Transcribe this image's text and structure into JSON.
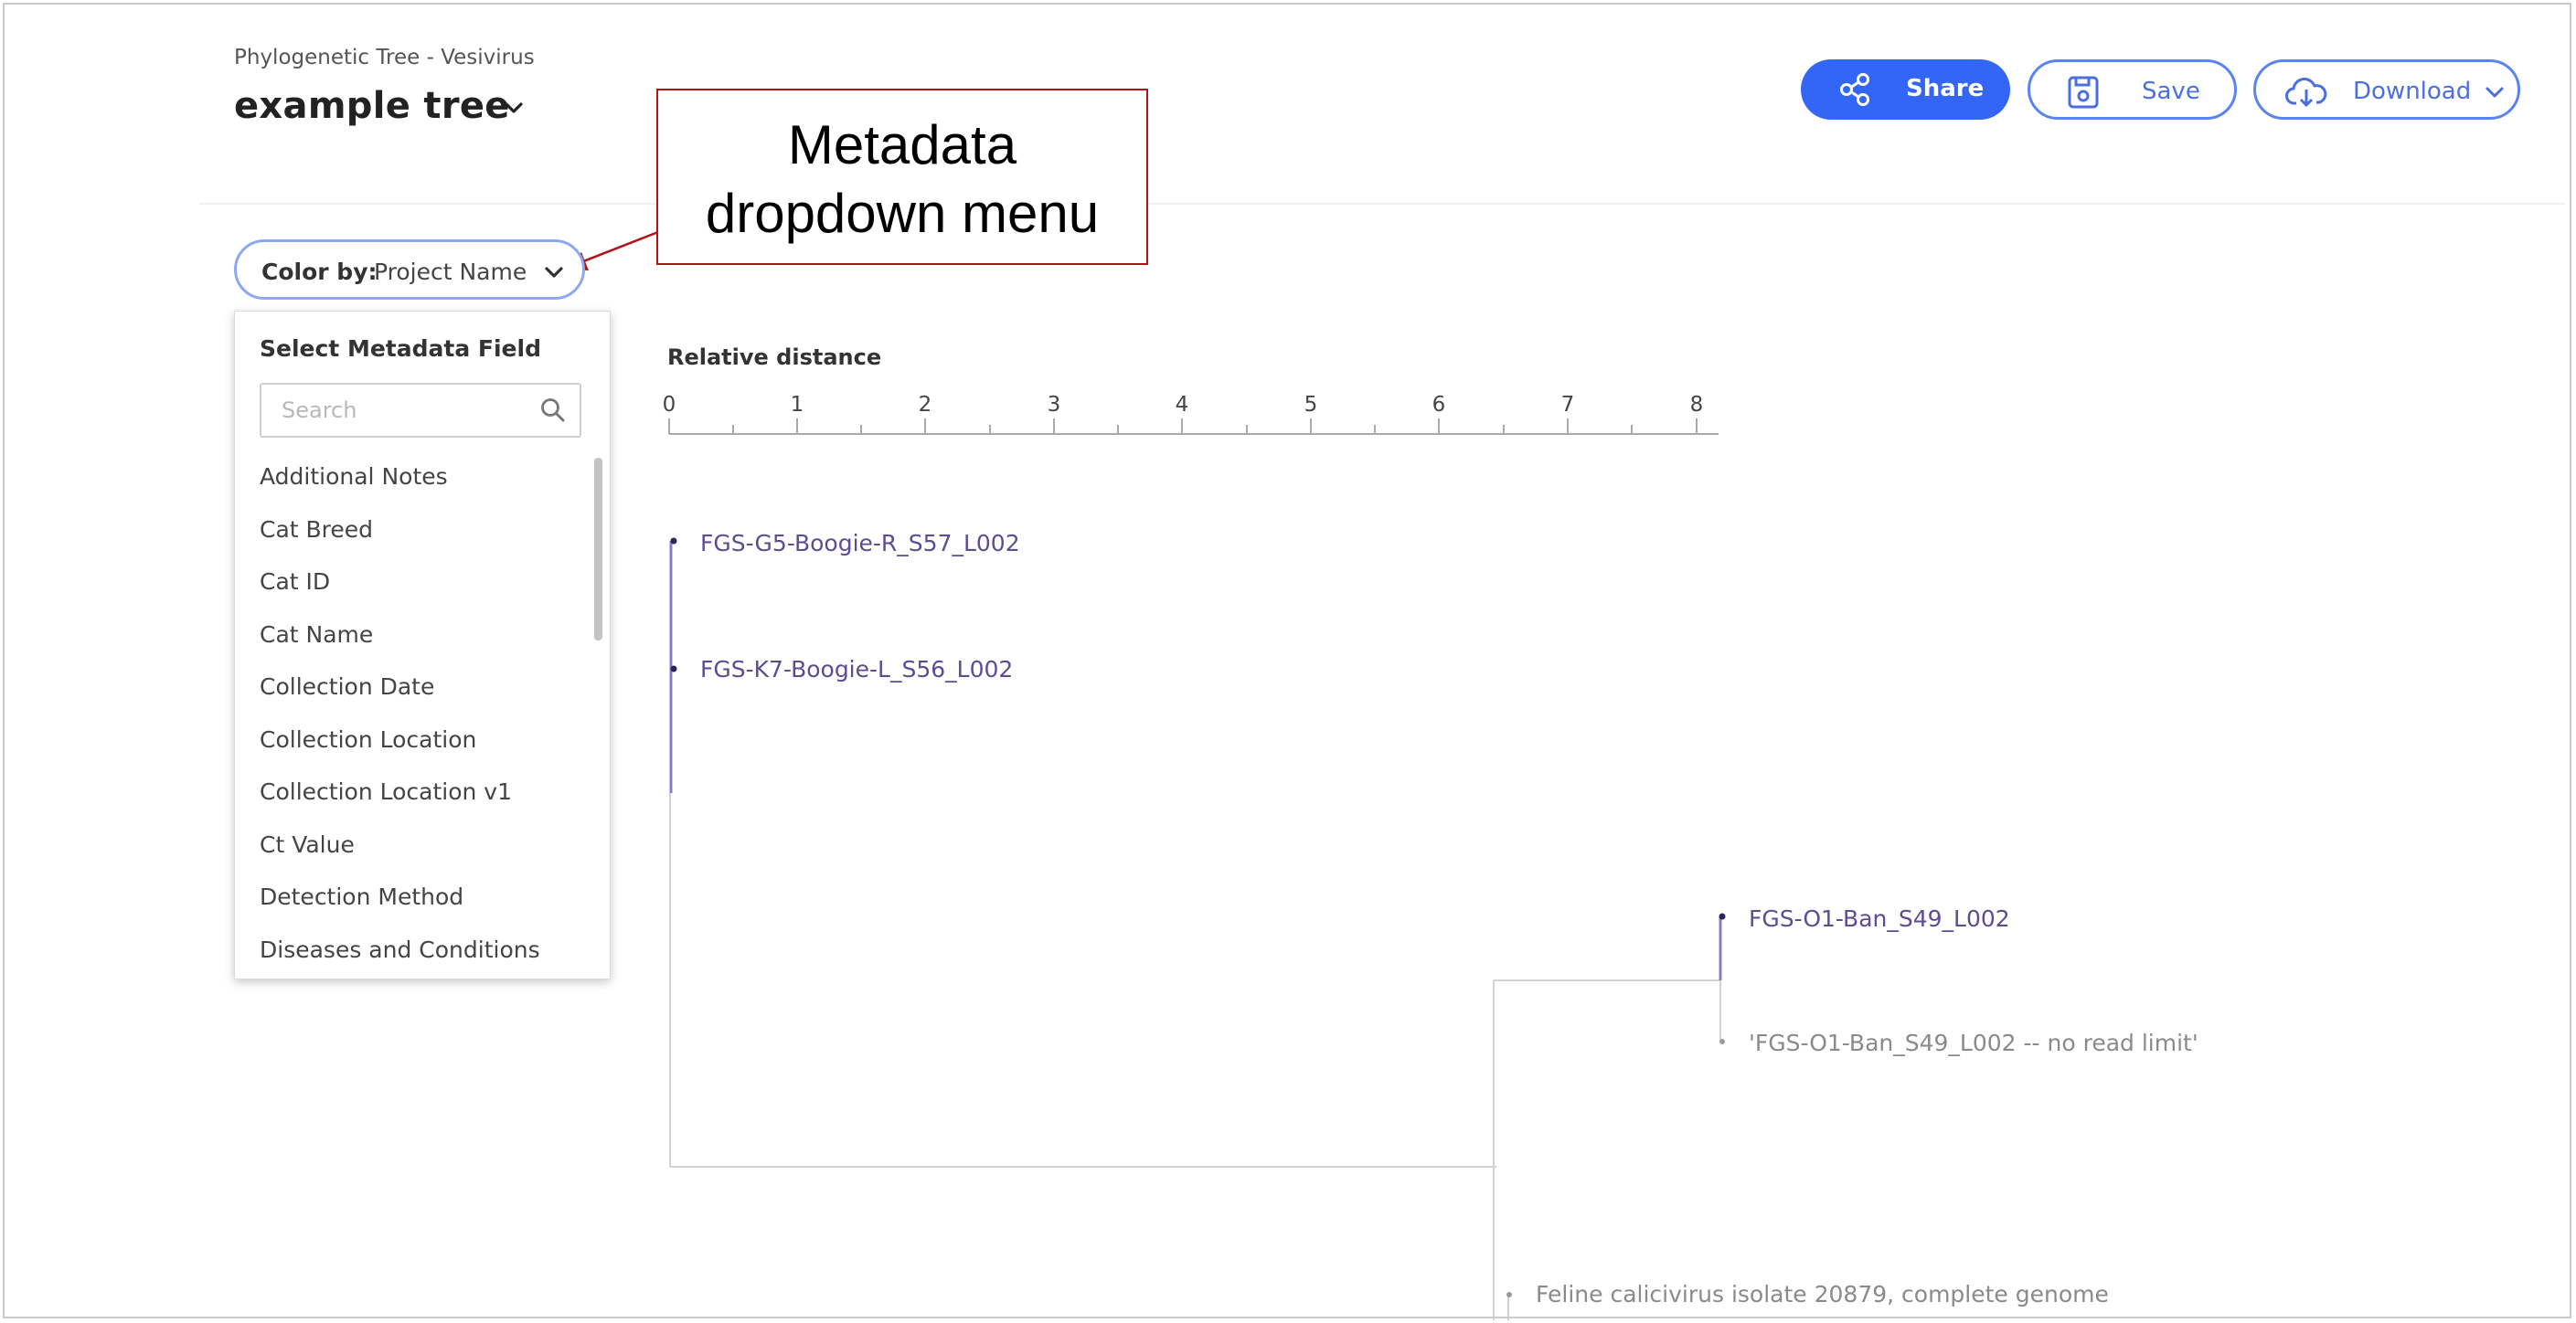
{
  "header": {
    "subtitle": "Phylogenetic Tree - Vesivirus",
    "title": "example tree"
  },
  "toolbar": {
    "share_label": "Share",
    "save_label": "Save",
    "download_label": "Download"
  },
  "annotation": {
    "line1": "Metadata",
    "line2": "dropdown menu"
  },
  "color_by": {
    "key": "Color by:",
    "value": "Project Name"
  },
  "dropdown": {
    "header": "Select Metadata Field",
    "search_placeholder": "Search",
    "items": [
      "Additional Notes",
      "Cat Breed",
      "Cat ID",
      "Cat Name",
      "Collection Date",
      "Collection Location",
      "Collection Location v1",
      "Ct Value",
      "Detection Method",
      "Diseases and Conditions"
    ]
  },
  "tree": {
    "axis_title": "Relative distance",
    "ticks": [
      "0",
      "1",
      "2",
      "3",
      "4",
      "5",
      "6",
      "7",
      "8"
    ],
    "leaves": [
      "FGS-G5-Boogie-R_S57_L002",
      "FGS-K7-Boogie-L_S56_L002",
      "FGS-O1-Ban_S49_L002",
      "'FGS-O1-Ban_S49_L002 -- no read limit'",
      "Feline calicivirus isolate 20879, complete genome"
    ]
  },
  "colors": {
    "primary_blue": "#3366f6",
    "leaf_purple": "#5e4c93",
    "annotation_red": "#b01318"
  },
  "icons": {
    "share": "share-icon",
    "save": "floppy-disk-icon",
    "download": "cloud-download-icon",
    "search": "search-icon"
  }
}
